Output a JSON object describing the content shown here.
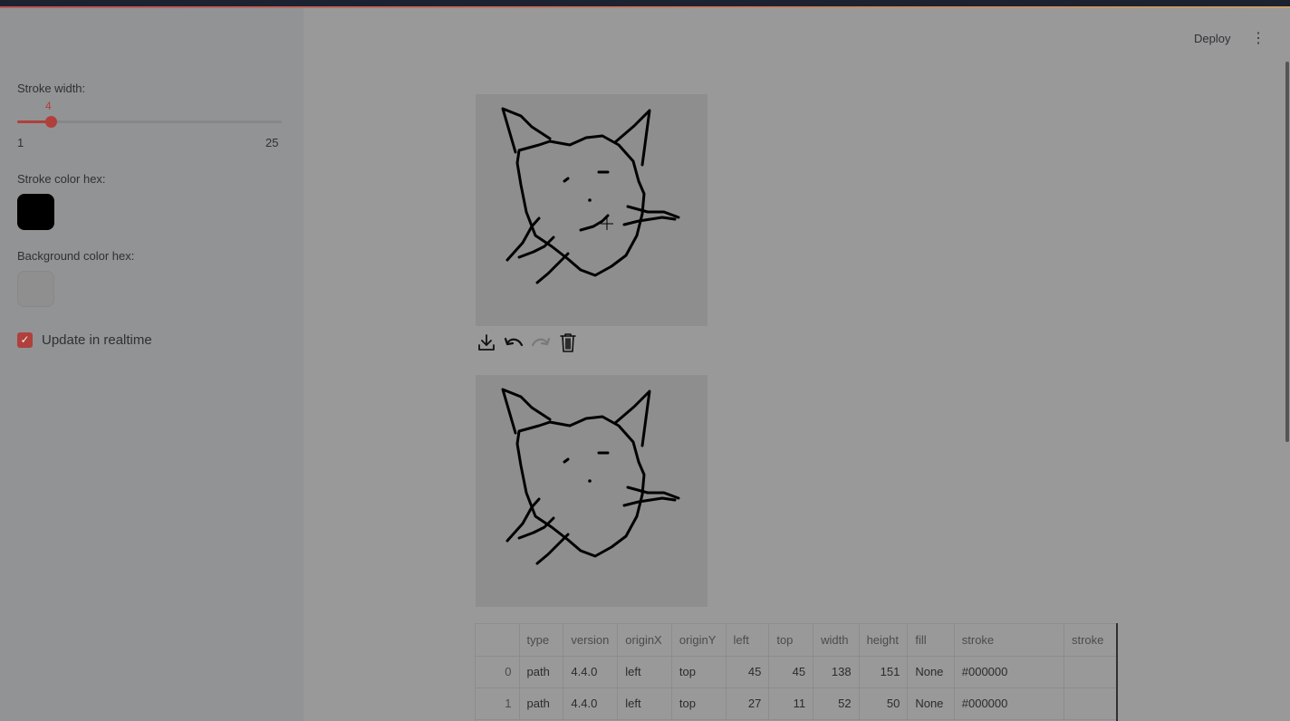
{
  "sidebar": {
    "stroke_width_label": "Stroke width:",
    "stroke_width_value": "4",
    "stroke_width_min": "1",
    "stroke_width_max": "25",
    "stroke_width_fraction": 0.125,
    "stroke_color_label": "Stroke color hex:",
    "stroke_color": "#000000",
    "background_color_label": "Background color hex:",
    "background_color": "#eeeeee",
    "realtime_label": "Update in realtime",
    "realtime_checked": true
  },
  "header": {
    "deploy_label": "Deploy",
    "menu_icon": "kebab-menu-icon"
  },
  "toolbar": {
    "icons": [
      "download-icon",
      "undo-icon",
      "redo-icon",
      "trash-icon"
    ]
  },
  "table": {
    "columns": [
      "",
      "type",
      "version",
      "originX",
      "originY",
      "left",
      "top",
      "width",
      "height",
      "fill",
      "stroke",
      "stroke"
    ],
    "rows": [
      [
        "0",
        "path",
        "4.4.0",
        "left",
        "top",
        "45",
        "45",
        "138",
        "151",
        "None",
        "#000000",
        ""
      ],
      [
        "1",
        "path",
        "4.4.0",
        "left",
        "top",
        "27",
        "11",
        "52",
        "50",
        "None",
        "#000000",
        ""
      ]
    ]
  },
  "colors": {
    "accent": "#b0403c"
  }
}
